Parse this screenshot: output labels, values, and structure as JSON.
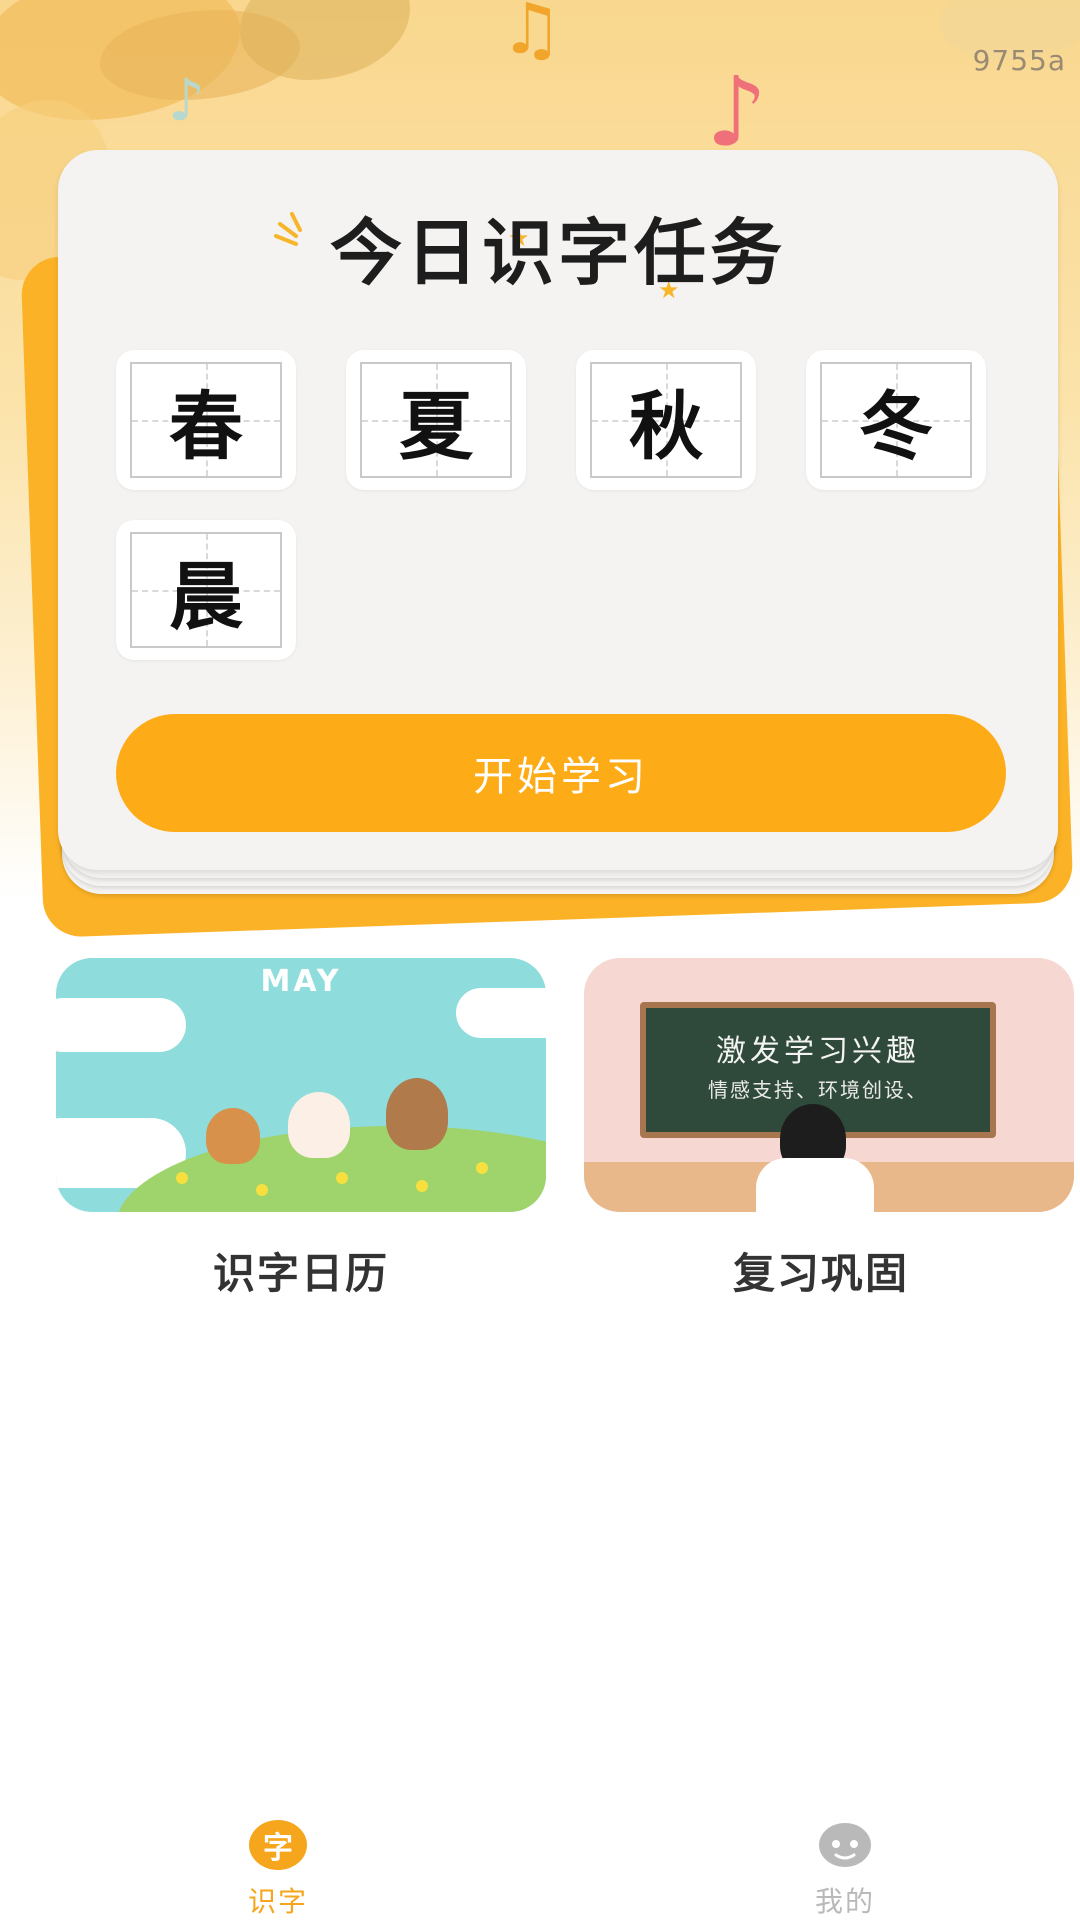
{
  "watermark": "9755a",
  "task_card": {
    "title": "今日识字任务",
    "characters": [
      "春",
      "夏",
      "秋",
      "冬",
      "晨"
    ],
    "start_button": "开始学习"
  },
  "features": [
    {
      "label": "识字日历",
      "image_text": "MAY"
    },
    {
      "label": "复习巩固",
      "image_text_line1": "激发学习兴趣",
      "image_text_line2": "情感支持、环境创设、"
    }
  ],
  "bottom_nav": {
    "items": [
      {
        "label": "识字",
        "icon": "字",
        "active": true
      },
      {
        "label": "我的",
        "icon": "face-icon",
        "active": false
      }
    ]
  },
  "colors": {
    "accent": "#fdac18",
    "nav_active": "#f6a61c",
    "nav_inactive": "#b9b9b9"
  }
}
